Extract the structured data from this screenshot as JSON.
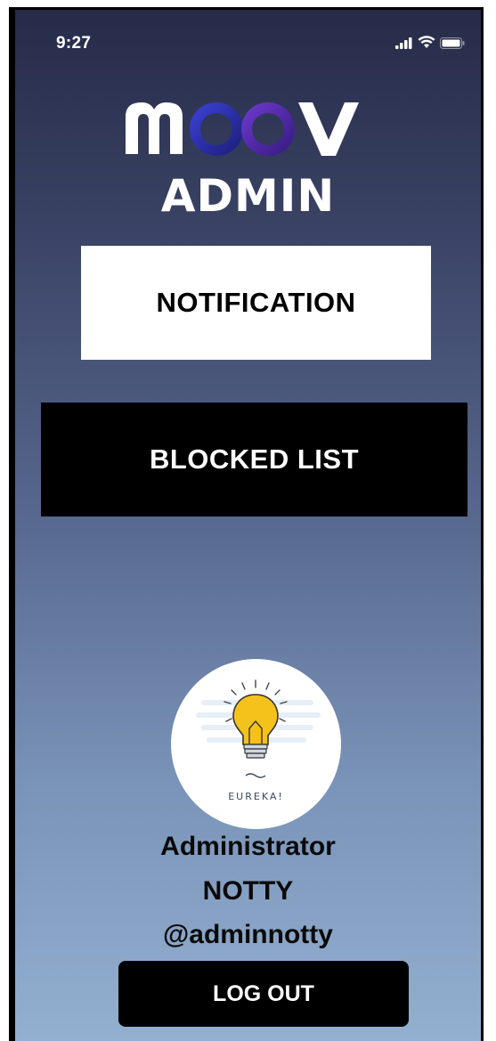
{
  "status_bar": {
    "time": "9:27",
    "icons": [
      "signal-icon",
      "wifi-icon",
      "battery-icon"
    ]
  },
  "logo": {
    "text": "MOOV",
    "letters": [
      "M",
      "O",
      "O",
      "V"
    ],
    "colors": {
      "white": "#ffffff",
      "ring_left": "#2a2fb8",
      "ring_right": "#5a2aa8"
    }
  },
  "title": "ADMIN",
  "menu": {
    "notification_label": "NOTIFICATION",
    "blocked_list_label": "BLOCKED LIST"
  },
  "profile": {
    "avatar_caption": "EUREKA!",
    "role": "Administrator",
    "name": "NOTTY",
    "handle": "@adminnotty"
  },
  "logout_label": "LOG OUT",
  "colors": {
    "gradient_top": "#262b48",
    "gradient_bottom": "#93b0d0",
    "button_dark": "#000000",
    "button_light": "#ffffff",
    "bulb": "#f5c21b"
  }
}
